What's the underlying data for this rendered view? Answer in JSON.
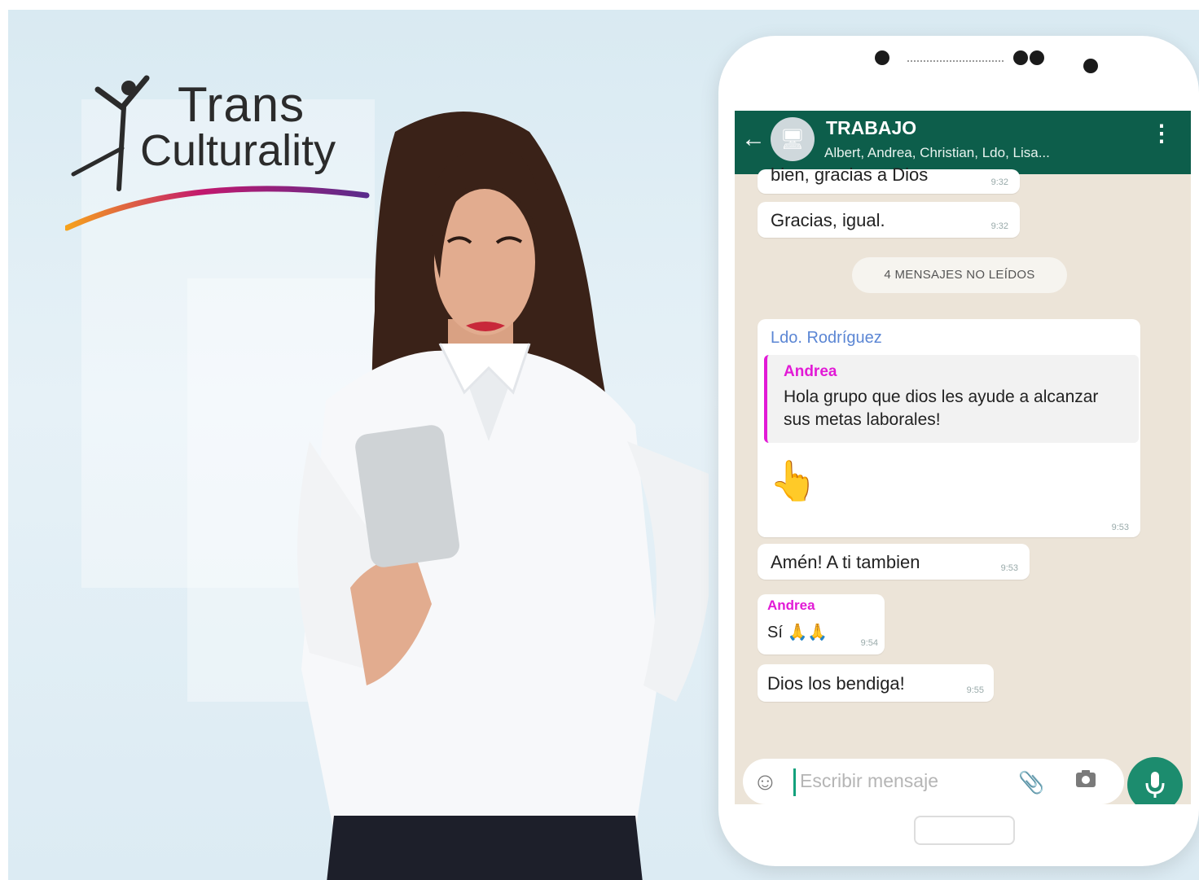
{
  "brand": {
    "line1": "Trans",
    "line2": "Culturality"
  },
  "chat": {
    "title": "TRABAJO",
    "members": "Albert, Andrea, Christian, Ldo, Lisa...",
    "unread_banner": "4 MENSAJES NO LEÍDOS",
    "messages": [
      {
        "text": "bien, gracias a Dios",
        "time": "9:32"
      },
      {
        "text": "Gracias, igual.",
        "time": "9:32"
      },
      {
        "sender": "Ldo. Rodríguez",
        "quote_sender": "Andrea",
        "quote_text": "Hola grupo que dios les ayude a alcanzar sus metas laborales!",
        "emoji": "👆",
        "time": "9:53"
      },
      {
        "text": "Amén! A ti tambien",
        "time": "9:53"
      },
      {
        "sender": "Andrea",
        "text": "Sí 🙏🙏",
        "time": "9:54"
      },
      {
        "text": "Dios los bendiga!",
        "time": "9:55"
      }
    ],
    "input_placeholder": "Escribir mensaje"
  },
  "colors": {
    "header": "#0d5e4b",
    "accent": "#1c8c6e",
    "andrea": "#e21ad6",
    "ldo": "#5b86d4"
  },
  "icons": [
    "back-arrow-icon",
    "group-avatar-icon",
    "menu-dots-icon",
    "smile-icon",
    "attach-icon",
    "camera-icon",
    "mic-icon",
    "pointing-up-emoji",
    "praying-hands-emoji"
  ]
}
